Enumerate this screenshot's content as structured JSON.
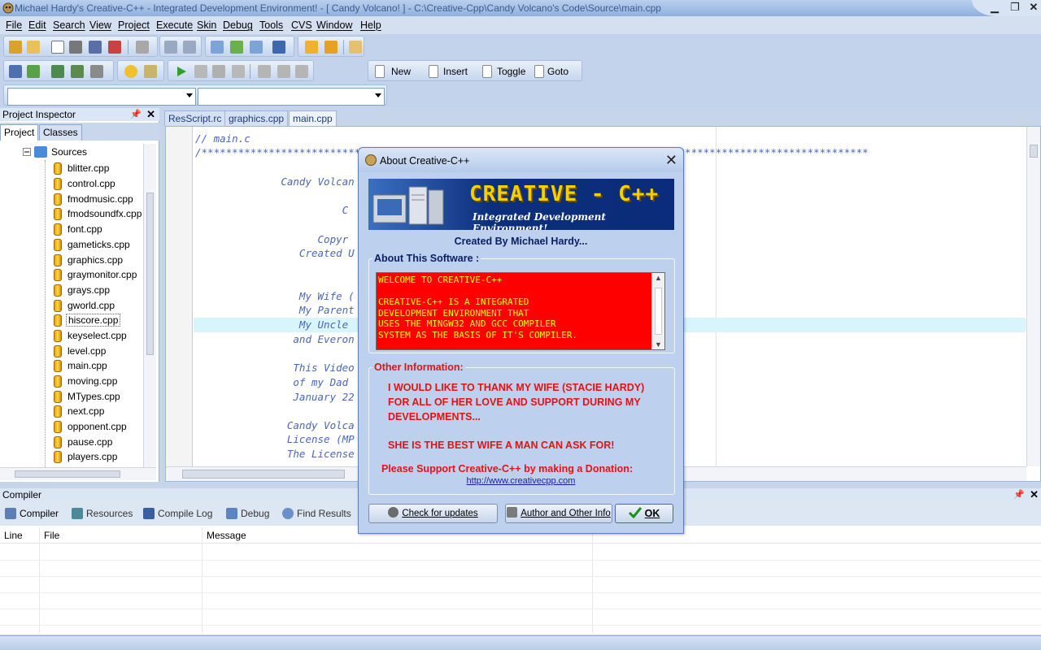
{
  "window": {
    "title": "Michael Hardy's Creative-C++ - Integrated Development Environment!  - [ Candy Volcano! ] - C:\\Creative-Cpp\\Candy Volcano's Code\\Source\\main.cpp"
  },
  "menu": [
    "File",
    "Edit",
    "Search",
    "View",
    "Project",
    "Execute",
    "Skin",
    "Debug",
    "Tools",
    "CVS",
    "Window",
    "Help"
  ],
  "toolbar": {
    "new_label": "New",
    "insert_label": "Insert",
    "toggle_label": "Toggle",
    "goto_label": "Goto"
  },
  "inspector": {
    "title": "Project Inspector",
    "tabs": [
      "Project",
      "Classes"
    ],
    "root": "Sources",
    "files": [
      "blitter.cpp",
      "control.cpp",
      "fmodmusic.cpp",
      "fmodsoundfx.cpp",
      "font.cpp",
      "gameticks.cpp",
      "graphics.cpp",
      "graymonitor.cpp",
      "grays.cpp",
      "gworld.cpp",
      "hiscore.cpp",
      "keyselect.cpp",
      "level.cpp",
      "main.cpp",
      "moving.cpp",
      "MTypes.cpp",
      "next.cpp",
      "opponent.cpp",
      "pause.cpp",
      "players.cpp"
    ]
  },
  "editor": {
    "tabs": [
      "ResScript.rc",
      "graphics.cpp",
      "main.cpp"
    ],
    "lines": [
      "// main.c",
      "/*************************************************************************************************************",
      "              Candy Volcan",
      "                        C",
      "                    Copyr",
      "                 Created U",
      "                 My Wife (",
      "                 My Parent",
      "                 My Uncle",
      "                and Everon",
      "                This Video",
      "                of my Dad",
      "                January 22",
      "               Candy Volca",
      "               License (MP",
      "               The License"
    ]
  },
  "compiler": {
    "title": "Compiler",
    "tabs": [
      "Compiler",
      "Resources",
      "Compile Log",
      "Debug",
      "Find Results"
    ],
    "columns": [
      "Line",
      "File",
      "Message"
    ]
  },
  "about": {
    "title": "About Creative-C++",
    "logo": "CREATIVE - C++",
    "logo_sub": "Integrated Development Environment!",
    "created_by": "Created By Michael Hardy...",
    "about_label": "About This Software :",
    "about_text": "WELCOME TO CREATIVE-C++\n\nCREATIVE-C++ IS A INTEGRATED\nDEVELOPMENT ENVIRONMENT THAT\nUSES THE MINGW32 AND GCC COMPILER\nSYSTEM AS THE BASIS OF IT'S COMPILER.",
    "other_label": "Other Information:",
    "thanks_1": "I WOULD LIKE TO THANK MY WIFE (STACIE HARDY)",
    "thanks_2": "FOR ALL OF HER LOVE AND SUPPORT DURING MY",
    "thanks_3": "DEVELOPMENTS...",
    "best_wife": "SHE IS THE BEST WIFE A MAN CAN ASK FOR!",
    "donate": "Please Support Creative-C++ by making a Donation:",
    "url": "http://www.creativecpp.com",
    "check_updates": "Check for updates",
    "author_info": "Author and Other Info",
    "ok": "OK"
  },
  "colors": {
    "accent": "#4a66b8",
    "alert_red": "#ff0000",
    "alert_text": "#ffff00",
    "info_red": "#e41313"
  }
}
